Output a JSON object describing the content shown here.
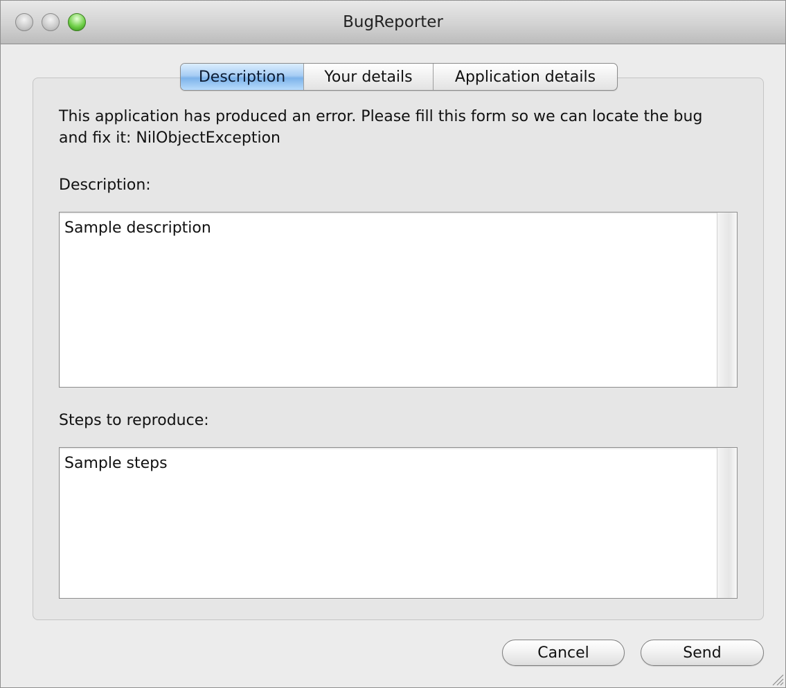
{
  "window": {
    "title": "BugReporter"
  },
  "tabs": [
    {
      "label": "Description",
      "active": true
    },
    {
      "label": "Your details",
      "active": false
    },
    {
      "label": "Application details",
      "active": false
    }
  ],
  "form": {
    "intro_text": "This application has produced an error. Please fill this form so we can locate the bug and fix it:  NilObjectException",
    "description_label": "Description:",
    "description_value": "Sample description",
    "steps_label": "Steps to reproduce:",
    "steps_value": "Sample steps"
  },
  "buttons": {
    "cancel_label": "Cancel",
    "send_label": "Send"
  },
  "icons": {
    "close": "close-icon",
    "minimize": "minimize-icon",
    "zoom": "zoom-icon",
    "resize": "resize-grip-icon"
  },
  "colors": {
    "active_tab": "#7db3ea",
    "zoom_button": "#71d04a"
  }
}
